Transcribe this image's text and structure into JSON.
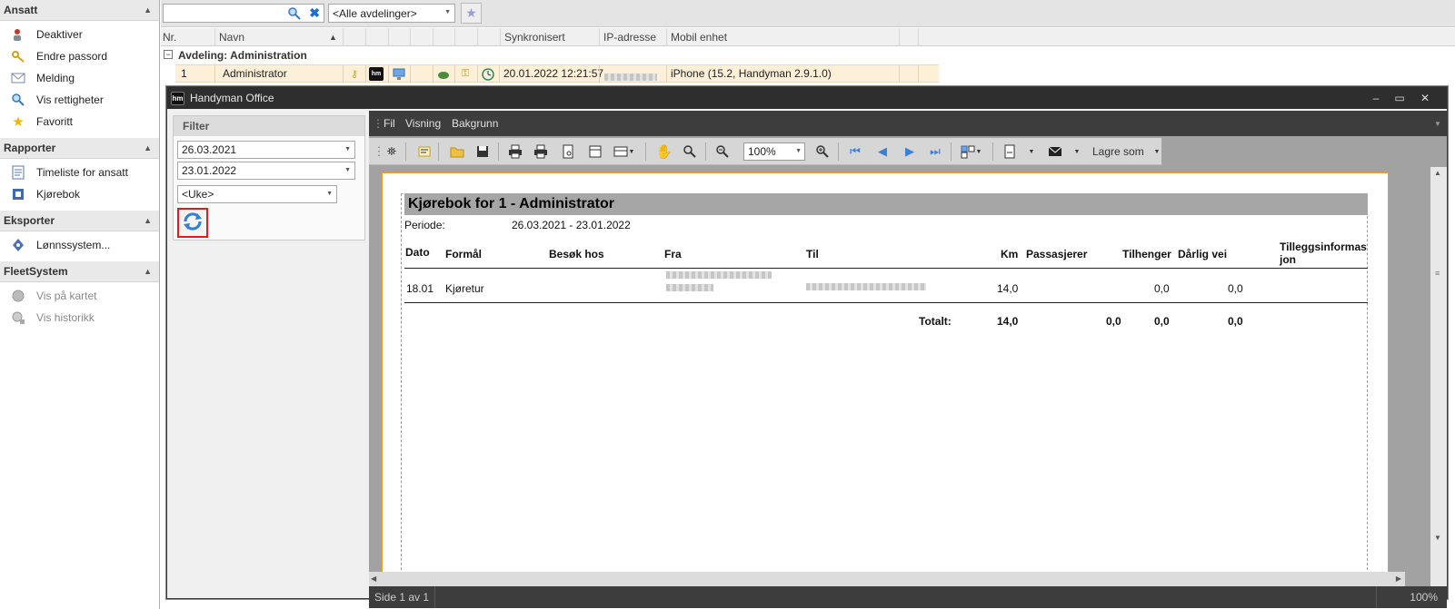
{
  "sidebar": {
    "groups": [
      {
        "title": "Ansatt",
        "items": [
          {
            "label": "Deaktiver",
            "icon": "person-off-icon"
          },
          {
            "label": "Endre passord",
            "icon": "key-icon"
          },
          {
            "label": "Melding",
            "icon": "envelope-icon"
          },
          {
            "label": "Vis rettigheter",
            "icon": "magnifier-icon"
          },
          {
            "label": "Favoritt",
            "icon": "star-icon"
          }
        ]
      },
      {
        "title": "Rapporter",
        "items": [
          {
            "label": "Timeliste for ansatt",
            "icon": "timesheet-icon"
          },
          {
            "label": "Kjørebok",
            "icon": "logbook-icon"
          }
        ]
      },
      {
        "title": "Eksporter",
        "items": [
          {
            "label": "Lønnssystem...",
            "icon": "export-icon"
          }
        ]
      },
      {
        "title": "FleetSystem",
        "items": [
          {
            "label": "Vis på kartet",
            "icon": "globe-icon"
          },
          {
            "label": "Vis historikk",
            "icon": "history-icon"
          }
        ]
      }
    ]
  },
  "topbar": {
    "search_value": "",
    "department_select": "<Alle avdelinger>"
  },
  "grid": {
    "columns": [
      "Nr.",
      "Navn",
      "Synkronisert",
      "IP-adresse",
      "Mobil enhet"
    ],
    "group_label": "Avdeling: Administration",
    "row": {
      "nr": "1",
      "navn": "Administrator",
      "synkronisert": "20.01.2022 12:21:57",
      "mobil_enhet": "iPhone (15.2, Handyman 2.9.1.0)"
    }
  },
  "window": {
    "title": "Handyman Office",
    "logo_text": "hm",
    "filter": {
      "header": "Filter",
      "from_date": "26.03.2021",
      "to_date": "23.01.2022",
      "period_select": "<Uke>"
    },
    "menu": [
      "Fil",
      "Visning",
      "Bakgrunn"
    ],
    "toolbar": {
      "zoom": "100%",
      "save_as_label": "Lagre som"
    },
    "report": {
      "title": "Kjørebok for  1 - Administrator",
      "period_label": "Periode:",
      "period_value": "26.03.2021  -  23.01.2022",
      "headers": {
        "dato": "Dato",
        "formal": "Formål",
        "besok": "Besøk hos",
        "fra": "Fra",
        "til": "Til",
        "km": "Km",
        "passasjerer": "Passasjerer",
        "tilhenger": "Tilhenger",
        "darlig_vei": "Dårlig vei",
        "tillegg_1": "Tilleggsinformas",
        "tillegg_2": "jon"
      },
      "row": {
        "dato": "18.01",
        "formal": "Kjøretur",
        "km": "14,0",
        "tilhenger": "0,0",
        "darlig_vei": "0,0"
      },
      "totals": {
        "label": "Totalt:",
        "km": "14,0",
        "passasjerer": "0,0",
        "tilhenger": "0,0",
        "darlig_vei": "0,0"
      }
    },
    "status": {
      "page": "Side 1 av 1",
      "zoom": "100%"
    }
  }
}
